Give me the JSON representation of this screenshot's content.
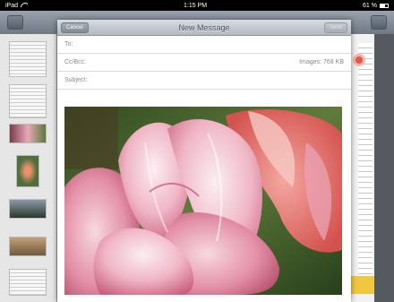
{
  "status_bar": {
    "device": "iPad",
    "time": "1:15 PM",
    "battery": "61 %"
  },
  "composer": {
    "title": "New Message",
    "cancel_label": "Cancel",
    "send_label": "Send",
    "to_label": "To:",
    "ccbcc_label": "Cc/Bcc:",
    "images_label": "Images:",
    "images_size": "768 KB",
    "subject_label": "Subject:"
  },
  "attachment": {
    "icon": "tulip-photo"
  },
  "colors": {
    "statusbar": "#000000",
    "navbar_top": "#d8dce1",
    "navbar_bottom": "#b2b9c1"
  }
}
